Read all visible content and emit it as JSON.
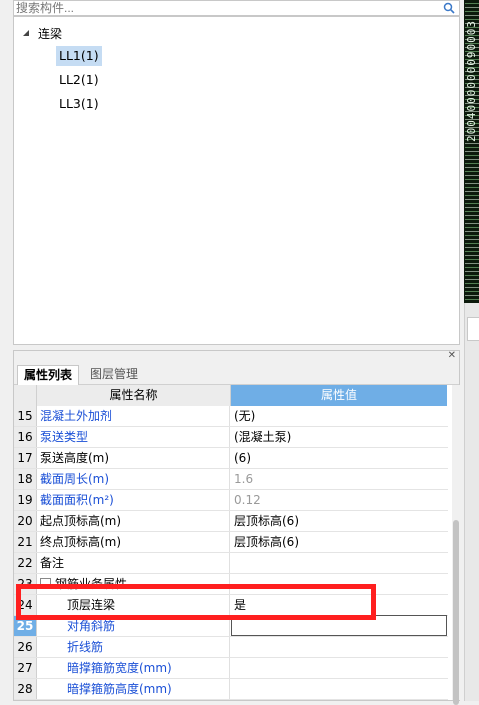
{
  "search": {
    "placeholder": "搜索构件..."
  },
  "tree": {
    "root_label": "连梁",
    "items": [
      {
        "label": "LL1(1)",
        "selected": true
      },
      {
        "label": "LL2(1)",
        "selected": false
      },
      {
        "label": "LL3(1)",
        "selected": false
      }
    ]
  },
  "right_strip_text": "2004000000090003",
  "panel": {
    "tabs": [
      {
        "label": "属性列表"
      },
      {
        "label": "图层管理"
      }
    ],
    "columns": {
      "name": "属性名称",
      "value": "属性值"
    },
    "rows": [
      {
        "num": "15",
        "name": "混凝土外加剂",
        "value": "(无)",
        "style": "blue"
      },
      {
        "num": "16",
        "name": "泵送类型",
        "value": "(混凝土泵)",
        "style": "blue"
      },
      {
        "num": "17",
        "name": "泵送高度(m)",
        "value": "(6)",
        "style": "normal"
      },
      {
        "num": "18",
        "name": "截面周长(m)",
        "value": "1.6",
        "style": "blue-gray"
      },
      {
        "num": "19",
        "name": "截面面积(m²)",
        "value": "0.12",
        "style": "blue-gray"
      },
      {
        "num": "20",
        "name": "起点顶标高(m)",
        "value": "层顶标高(6)",
        "style": "normal"
      },
      {
        "num": "21",
        "name": "终点顶标高(m)",
        "value": "层顶标高(6)",
        "style": "normal"
      },
      {
        "num": "22",
        "name": "备注",
        "value": "",
        "style": "normal"
      },
      {
        "num": "23",
        "name": "钢筋业务属性",
        "value": "",
        "style": "group"
      },
      {
        "num": "24",
        "name": "顶层连梁",
        "value": "是",
        "style": "indent"
      },
      {
        "num": "25",
        "name": "对角斜筋",
        "value": "",
        "style": "indent-blue-current"
      },
      {
        "num": "26",
        "name": "折线筋",
        "value": "",
        "style": "indent-blue"
      },
      {
        "num": "27",
        "name": "暗撑箍筋宽度(mm)",
        "value": "",
        "style": "indent-blue"
      },
      {
        "num": "28",
        "name": "暗撑箍筋高度(mm)",
        "value": "",
        "style": "indent-blue"
      }
    ]
  },
  "colors": {
    "accent": "#6faee6",
    "link_blue": "#1a4fd6",
    "highlight_red": "#ff1f1f",
    "selection": "#c5dcf3"
  }
}
